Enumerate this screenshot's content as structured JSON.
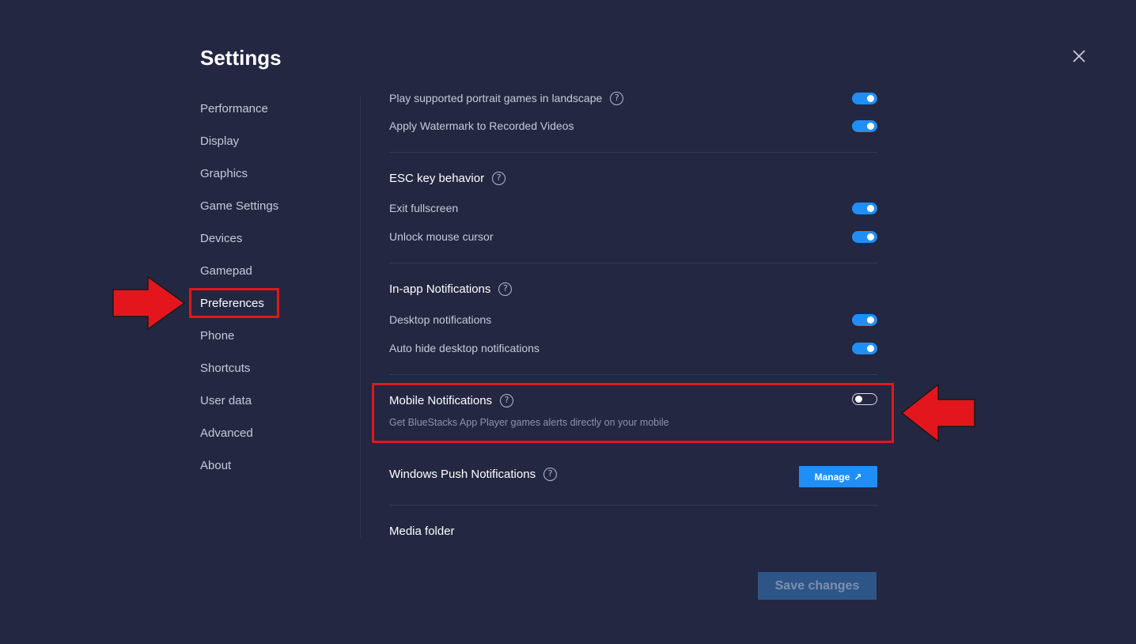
{
  "title": "Settings",
  "sidebar": {
    "items": [
      {
        "label": "Performance"
      },
      {
        "label": "Display"
      },
      {
        "label": "Graphics"
      },
      {
        "label": "Game Settings"
      },
      {
        "label": "Devices"
      },
      {
        "label": "Gamepad"
      },
      {
        "label": "Preferences"
      },
      {
        "label": "Phone"
      },
      {
        "label": "Shortcuts"
      },
      {
        "label": "User data"
      },
      {
        "label": "Advanced"
      },
      {
        "label": "About"
      }
    ],
    "active": "Preferences"
  },
  "content": {
    "general": {
      "portrait_label": "Play supported portrait games in landscape",
      "portrait_on": true,
      "watermark_label": "Apply Watermark to Recorded Videos",
      "watermark_on": true
    },
    "esc": {
      "title": "ESC key behavior",
      "exit_fullscreen_label": "Exit fullscreen",
      "exit_fullscreen_on": true,
      "unlock_mouse_label": "Unlock mouse cursor",
      "unlock_mouse_on": true
    },
    "inapp": {
      "title": "In-app Notifications",
      "desktop_label": "Desktop notifications",
      "desktop_on": true,
      "autohide_label": "Auto hide desktop notifications",
      "autohide_on": true
    },
    "mobile": {
      "title": "Mobile Notifications",
      "description": "Get BlueStacks App Player games alerts directly on your mobile",
      "on": false
    },
    "windows_push": {
      "title": "Windows Push Notifications",
      "manage_label": "Manage",
      "manage_icon": "↗"
    },
    "media": {
      "title": "Media folder"
    }
  },
  "help_icon_glyph": "?",
  "save_label": "Save changes",
  "colors": {
    "background": "#232741",
    "accent": "#1f8ff7",
    "highlight": "#e3161e",
    "save_disabled": "#2e5587"
  }
}
